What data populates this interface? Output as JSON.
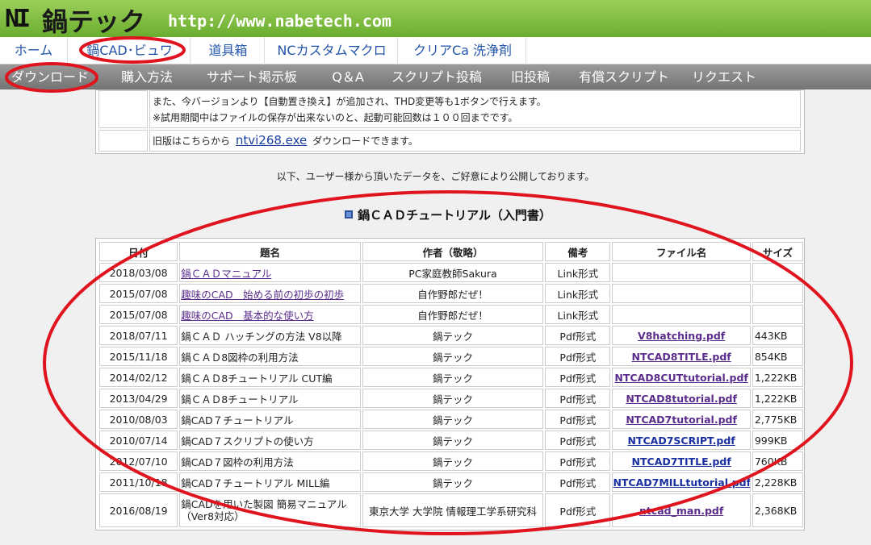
{
  "header": {
    "logo_mark": "NI",
    "site_name": "鍋テック",
    "url": "http://www.nabetech.com"
  },
  "nav_primary": [
    {
      "label": "ホーム"
    },
    {
      "label": "鍋CAD･ビュワ"
    },
    {
      "label": "道具箱"
    },
    {
      "label": "NCカスタムマクロ"
    },
    {
      "label": "クリアCa 洗浄剤"
    }
  ],
  "nav_secondary": [
    {
      "label": "ダウンロード"
    },
    {
      "label": "購入方法"
    },
    {
      "label": "サポート掲示板"
    },
    {
      "label": "Q＆A"
    },
    {
      "label": "スクリプト投稿"
    },
    {
      "label": "旧投稿"
    },
    {
      "label": "有償スクリプト"
    },
    {
      "label": "リクエスト"
    }
  ],
  "info": {
    "line1": "また、今バージョンより【自動置き換え】が追加され、THD変更等も1ボタンで行えます。",
    "line2": "※試用期間中はファイルの保存が出来ないのと、起動可能回数は１００回までです。",
    "old_prefix": "旧版はこちらから",
    "old_link": "ntvi268.exe",
    "old_suffix": "ダウンロードできます。"
  },
  "notice": "以下、ユーザー様から頂いたデータを、ご好意により公開しております。",
  "section_title": "鍋ＣＡＤチュートリアル（入門書）",
  "table": {
    "headers": [
      "日付",
      "題名",
      "作者（敬略）",
      "備考",
      "ファイル名",
      "サイズ"
    ],
    "rows": [
      {
        "date": "2018/03/08",
        "title": "鍋ＣＡＤマニュアル",
        "author": "PC家庭教師Sakura",
        "note": "Link形式",
        "file": "",
        "size": ""
      },
      {
        "date": "2015/07/08",
        "title": "趣味のCAD　始める前の初歩の初歩",
        "author": "自作野郎だぜ！",
        "note": "Link形式",
        "file": "",
        "size": ""
      },
      {
        "date": "2015/07/08",
        "title": "趣味のCAD　基本的な使い方",
        "author": "自作野郎だぜ！",
        "note": "Link形式",
        "file": "",
        "size": ""
      },
      {
        "date": "2018/07/11",
        "title": "鍋ＣＡＤ ハッチングの方法 V8以降",
        "author": "鍋テック",
        "note": "Pdf形式",
        "file": "V8hatching.pdf",
        "size": "443KB"
      },
      {
        "date": "2015/11/18",
        "title": "鍋ＣＡＤ8図枠の利用方法",
        "author": "鍋テック",
        "note": "Pdf形式",
        "file": "NTCAD8TITLE.pdf",
        "size": "854KB"
      },
      {
        "date": "2014/02/12",
        "title": "鍋ＣＡＤ8チュートリアル CUT編",
        "author": "鍋テック",
        "note": "Pdf形式",
        "file": "NTCAD8CUTtutorial.pdf",
        "size": "1,222KB"
      },
      {
        "date": "2013/04/29",
        "title": "鍋ＣＡＤ8チュートリアル",
        "author": "鍋テック",
        "note": "Pdf形式",
        "file": "NTCAD8tutorial.pdf",
        "size": "1,222KB"
      },
      {
        "date": "2010/08/03",
        "title": "鍋CAD７チュートリアル",
        "author": "鍋テック",
        "note": "Pdf形式",
        "file": "NTCAD7tutorial.pdf",
        "size": "2,775KB"
      },
      {
        "date": "2010/07/14",
        "title": "鍋CAD７スクリプトの使い方",
        "author": "鍋テック",
        "note": "Pdf形式",
        "file": "NTCAD7SCRIPT.pdf",
        "size": "999KB"
      },
      {
        "date": "2012/07/10",
        "title": "鍋CAD７図枠の利用方法",
        "author": "鍋テック",
        "note": "Pdf形式",
        "file": "NTCAD7TITLE.pdf",
        "size": "760KB"
      },
      {
        "date": "2011/10/18",
        "title": "鍋CAD７チュートリアル MILL編",
        "author": "鍋テック",
        "note": "Pdf形式",
        "file": "NTCAD7MILLtutorial.pdf",
        "size": "2,228KB"
      },
      {
        "date": "2016/08/19",
        "title": "鍋CADを用いた製図 簡易マニュアル（Ver8対応）",
        "author": "東京大学 大学院 情報理工学系研究科",
        "note": "Pdf形式",
        "file": "ntcad_man.pdf",
        "size": "2,368KB"
      }
    ]
  },
  "colors": {
    "header_green": "#7ab83f",
    "nav_link": "#2255aa",
    "annotation_red": "#e0141e",
    "file_link": "#5a2d8c"
  }
}
